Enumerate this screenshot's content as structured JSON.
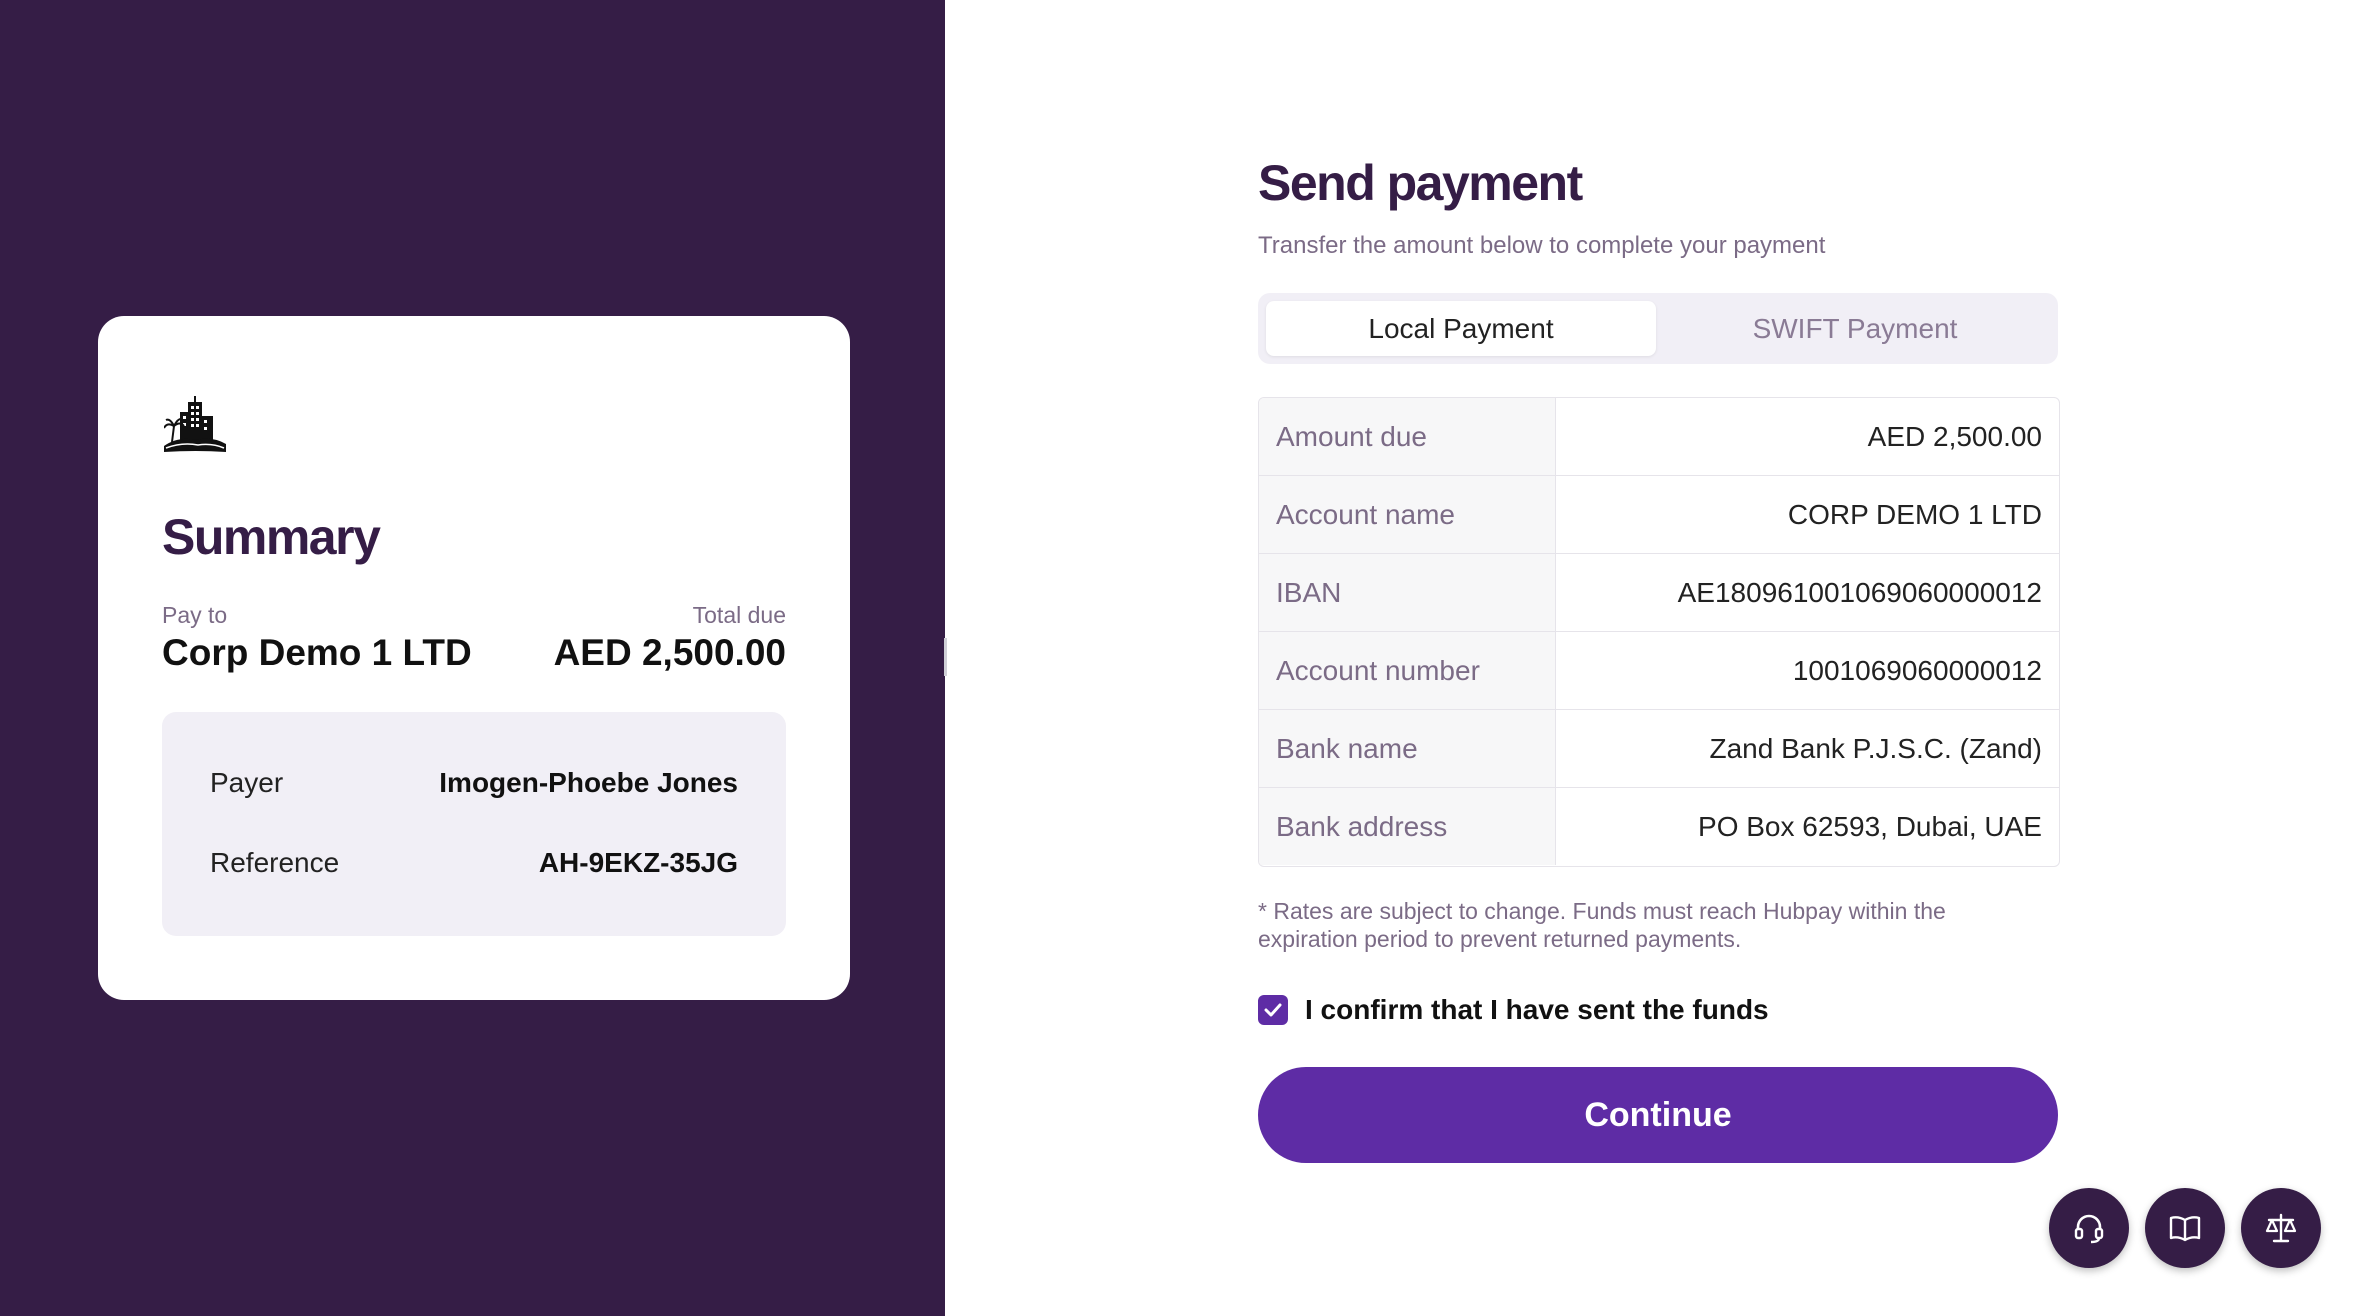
{
  "colors": {
    "brand_dark": "#351d46",
    "accent": "#5e2ca5",
    "muted_text": "#7b6b86",
    "panel_bg": "#f1eff6"
  },
  "summary": {
    "logo_icon": "building-palm-icon",
    "title": "Summary",
    "pay_to_label": "Pay to",
    "pay_to_value": "Corp Demo 1 LTD",
    "total_due_label": "Total due",
    "total_due_value": "AED 2,500.00",
    "details": [
      {
        "label": "Payer",
        "value": "Imogen-Phoebe Jones"
      },
      {
        "label": "Reference",
        "value": "AH-9EKZ-35JG"
      }
    ]
  },
  "payment": {
    "title": "Send payment",
    "subtitle": "Transfer the amount below to complete your payment",
    "tabs": [
      {
        "label": "Local Payment",
        "active": true
      },
      {
        "label": "SWIFT Payment",
        "active": false
      }
    ],
    "rows": [
      {
        "label": "Amount due",
        "value": "AED 2,500.00"
      },
      {
        "label": "Account name",
        "value": "CORP DEMO 1 LTD"
      },
      {
        "label": "IBAN",
        "value": "AE180961001069060000012"
      },
      {
        "label": "Account number",
        "value": "1001069060000012"
      },
      {
        "label": "Bank name",
        "value": "Zand Bank P.J.S.C. (Zand)"
      },
      {
        "label": "Bank address",
        "value": "PO Box 62593, Dubai, UAE"
      }
    ],
    "note": "* Rates are subject to change. Funds must reach Hubpay within the expiration period to prevent returned payments.",
    "confirm_label": "I confirm that I have sent the funds",
    "confirm_checked": true,
    "continue_label": "Continue"
  },
  "floating_buttons": [
    {
      "icon": "headset-icon"
    },
    {
      "icon": "book-icon"
    },
    {
      "icon": "scale-icon"
    }
  ]
}
